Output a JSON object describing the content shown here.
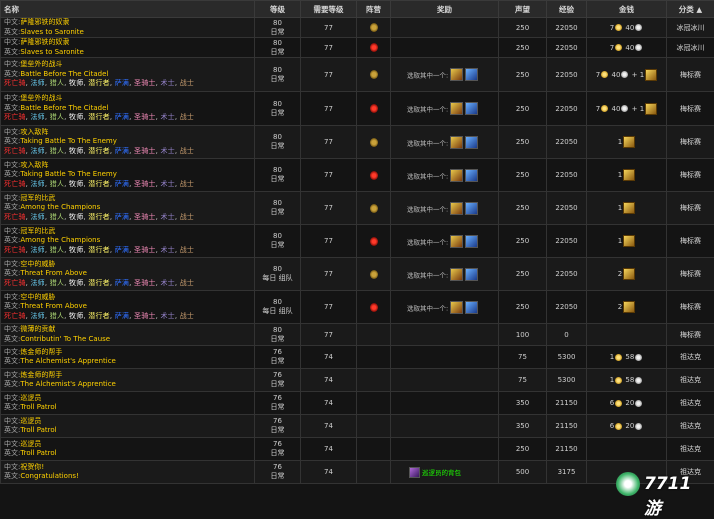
{
  "headers": [
    "名称",
    "等级",
    "需要等级",
    "阵营",
    "奖励",
    "声望",
    "经验",
    "金钱",
    "分类"
  ],
  "sort_arrow": "▲",
  "lang_cn": "中文:",
  "lang_en": "英文:",
  "class_labels": {
    "dk": "死亡骑",
    "mage": "法师",
    "hunter": "猎人",
    "priest": "牧师",
    "rogue": "潜行者",
    "shaman": "萨满",
    "paladin": "圣骑士",
    "lock": "术士",
    "warrior": "战士"
  },
  "reward_choose": "选取其中一个:",
  "colors": {
    "title": "#ffd100",
    "alliance": "#caa23a",
    "horde": "#ff3a2a",
    "bag": "#1eff00"
  },
  "rows": [
    {
      "cn": "萨隆邪铁的奴隶",
      "en": "Slaves to Saronite",
      "classes": false,
      "lvl": "80",
      "type": "日常",
      "req": "77",
      "side": "alliance",
      "reward": "",
      "rep": "250",
      "xp": "22050",
      "gold": "7",
      "silver": "40",
      "badge": "",
      "cat": "冰冠冰川"
    },
    {
      "cn": "萨隆邪铁的奴隶",
      "en": "Slaves to Saronite",
      "classes": false,
      "lvl": "80",
      "type": "日常",
      "req": "77",
      "side": "horde",
      "reward": "",
      "rep": "250",
      "xp": "22050",
      "gold": "7",
      "silver": "40",
      "badge": "",
      "cat": "冰冠冰川"
    },
    {
      "cn": "堡垒外的战斗",
      "en": "Battle Before The Citadel",
      "classes": true,
      "lvl": "80",
      "type": "日常",
      "req": "77",
      "side": "alliance",
      "reward": "choose",
      "rep": "250",
      "xp": "22050",
      "gold": "7",
      "silver": "40",
      "badge": "+ 1",
      "cat": "梅标赛"
    },
    {
      "cn": "堡垒外的战斗",
      "en": "Battle Before The Citadel",
      "classes": true,
      "lvl": "80",
      "type": "日常",
      "req": "77",
      "side": "horde",
      "reward": "choose",
      "rep": "250",
      "xp": "22050",
      "gold": "7",
      "silver": "40",
      "badge": "+ 1",
      "cat": "梅标赛"
    },
    {
      "cn": "攻入敌阵",
      "en": "Taking Battle To The Enemy",
      "classes": true,
      "lvl": "80",
      "type": "日常",
      "req": "77",
      "side": "alliance",
      "reward": "choose",
      "rep": "250",
      "xp": "22050",
      "gold": "",
      "silver": "",
      "badge": "1",
      "cat": "梅标赛"
    },
    {
      "cn": "攻入敌阵",
      "en": "Taking Battle To The Enemy",
      "classes": true,
      "lvl": "80",
      "type": "日常",
      "req": "77",
      "side": "horde",
      "reward": "choose",
      "rep": "250",
      "xp": "22050",
      "gold": "",
      "silver": "",
      "badge": "1",
      "cat": "梅标赛"
    },
    {
      "cn": "冠军的比武",
      "en": "Among the Champions",
      "classes": true,
      "lvl": "80",
      "type": "日常",
      "req": "77",
      "side": "alliance",
      "reward": "choose",
      "rep": "250",
      "xp": "22050",
      "gold": "",
      "silver": "",
      "badge": "1",
      "cat": "梅标赛"
    },
    {
      "cn": "冠军的比武",
      "en": "Among the Champions",
      "classes": true,
      "lvl": "80",
      "type": "日常",
      "req": "77",
      "side": "horde",
      "reward": "choose",
      "rep": "250",
      "xp": "22050",
      "gold": "",
      "silver": "",
      "badge": "1",
      "cat": "梅标赛"
    },
    {
      "cn": "空中的威胁",
      "en": "Threat From Above",
      "classes": true,
      "lvl": "80",
      "type": "每日 组队",
      "req": "77",
      "side": "alliance",
      "reward": "choose",
      "rep": "250",
      "xp": "22050",
      "gold": "",
      "silver": "",
      "badge": "2",
      "cat": "梅标赛"
    },
    {
      "cn": "空中的威胁",
      "en": "Threat From Above",
      "classes": true,
      "lvl": "80",
      "type": "每日 组队",
      "req": "77",
      "side": "horde",
      "reward": "choose",
      "rep": "250",
      "xp": "22050",
      "gold": "",
      "silver": "",
      "badge": "2",
      "cat": "梅标赛"
    },
    {
      "cn": "微薄的贡献",
      "en": "Contributin' To The Cause",
      "classes": false,
      "lvl": "80",
      "type": "日常",
      "req": "77",
      "side": "",
      "reward": "",
      "rep": "100",
      "xp": "0",
      "gold": "",
      "silver": "",
      "badge": "",
      "cat": "梅标赛"
    },
    {
      "cn": "炼金师的帮手",
      "en": "The Alchemist's Apprentice",
      "classes": false,
      "lvl": "76",
      "type": "日常",
      "req": "74",
      "side": "",
      "reward": "",
      "rep": "75",
      "xp": "5300",
      "gold": "1",
      "silver": "58",
      "badge": "",
      "cat": "祖达克"
    },
    {
      "cn": "炼金师的帮手",
      "en": "The Alchemist's Apprentice",
      "classes": false,
      "lvl": "76",
      "type": "日常",
      "req": "74",
      "side": "",
      "reward": "",
      "rep": "75",
      "xp": "5300",
      "gold": "1",
      "silver": "58",
      "badge": "",
      "cat": "祖达克"
    },
    {
      "cn": "巡逻员",
      "en": "Troll Patrol",
      "classes": false,
      "lvl": "76",
      "type": "日常",
      "req": "74",
      "side": "",
      "reward": "",
      "rep": "350",
      "xp": "21150",
      "gold": "6",
      "silver": "20",
      "badge": "",
      "cat": "祖达克"
    },
    {
      "cn": "巡逻员",
      "en": "Troll Patrol",
      "classes": false,
      "lvl": "76",
      "type": "日常",
      "req": "74",
      "side": "",
      "reward": "",
      "rep": "350",
      "xp": "21150",
      "gold": "6",
      "silver": "20",
      "badge": "",
      "cat": "祖达克"
    },
    {
      "cn": "巡逻员",
      "en": "Troll Patrol",
      "classes": false,
      "lvl": "76",
      "type": "日常",
      "req": "74",
      "side": "",
      "reward": "",
      "rep": "250",
      "xp": "21150",
      "gold": "",
      "silver": "",
      "badge": "",
      "cat": "祖达克"
    },
    {
      "cn": "祝贺你!",
      "en": "Congratulations!",
      "classes": false,
      "lvl": "76",
      "type": "日常",
      "req": "74",
      "side": "",
      "reward": "bag",
      "rep": "500",
      "xp": "3175",
      "gold": "",
      "silver": "",
      "badge": "",
      "cat": "祖达克"
    }
  ],
  "bag_label": "巡逻员的背包",
  "watermark": "7711游"
}
